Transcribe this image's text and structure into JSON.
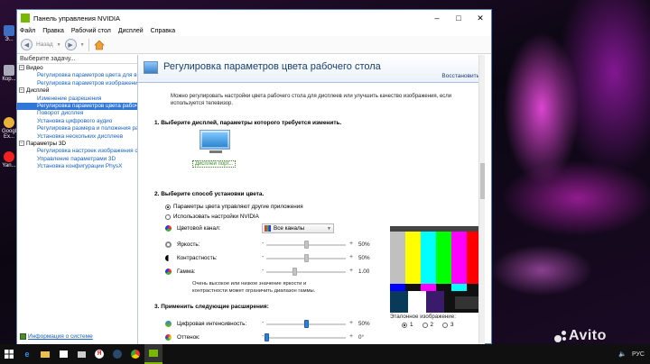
{
  "window": {
    "title": "Панель управления NVIDIA",
    "menu": [
      "Файл",
      "Правка",
      "Рабочий стол",
      "Дисплей",
      "Справка"
    ],
    "back_label": "Назад"
  },
  "desktop": {
    "icons": [
      {
        "label": "Э..."
      },
      {
        "label": "Кор..."
      },
      {
        "label": "Google Ex..."
      },
      {
        "label": "Yan..."
      }
    ]
  },
  "left_panel": {
    "header": "Выберите задачу...",
    "tree": [
      {
        "type": "cat",
        "label": "Видео"
      },
      {
        "type": "leaf",
        "label": "Регулировка параметров цвета для вид"
      },
      {
        "type": "leaf",
        "label": "Регулировка параметров изображения д"
      },
      {
        "type": "cat",
        "label": "Дисплей"
      },
      {
        "type": "leaf",
        "label": "Изменение разрешения"
      },
      {
        "type": "leaf",
        "label": "Регулировка параметров цвета рабочег",
        "selected": true
      },
      {
        "type": "leaf",
        "label": "Поворот дисплея"
      },
      {
        "type": "leaf",
        "label": "Установка цифрового аудио"
      },
      {
        "type": "leaf",
        "label": "Регулировка размера и положения рабоч"
      },
      {
        "type": "leaf",
        "label": "Установка нескольких дисплеев"
      },
      {
        "type": "cat",
        "label": "Параметры 3D"
      },
      {
        "type": "leaf",
        "label": "Регулировка настроек изображения с пр"
      },
      {
        "type": "leaf",
        "label": "Управление параметрами 3D"
      },
      {
        "type": "leaf",
        "label": "Установка конфигурации PhysX"
      }
    ],
    "footer_link": "Информация о системе"
  },
  "main": {
    "title": "Регулировка параметров цвета рабочего стола",
    "restore": "Восстановить",
    "description": "Можно регулировать настройки цвета рабочего стола для дисплеев или улучшить качество изображения, если используется телевизор.",
    "step1": "1. Выберите дисплей, параметры которого требуется изменить.",
    "display_label": "Дисплей порт...",
    "step2": "2. Выберите способ установки цвета.",
    "radio_other": "Параметры цвета управляют другие приложения",
    "radio_nvidia": "Использовать настройки NVIDIA",
    "channel_label": "Цветовой канал:",
    "channel_value": "Все каналы",
    "sliders": [
      {
        "label": "Яркость:",
        "value": "50%",
        "level": 0.5
      },
      {
        "label": "Контрастность:",
        "value": "50%",
        "level": 0.5
      },
      {
        "label": "Гамма:",
        "value": "1.00",
        "level": 0.35
      }
    ],
    "note": "Очень высокое или низкое значение яркости и контрастности может ограничить диапазон гаммы.",
    "step3": "3. Применить следующие расширения:",
    "enh_sliders": [
      {
        "label": "Цифровая интенсивность:",
        "value": "50%",
        "level": 0.5
      },
      {
        "label": "Оттенок:",
        "value": "0°",
        "level": 0.0
      }
    ],
    "reference_label": "Эталонное изображение:",
    "reference_options": [
      "1",
      "2",
      "3"
    ]
  },
  "taskbar": {
    "lang": "РУС",
    "watermark": "Avito"
  },
  "colors": {
    "nvidia_green": "#76b900",
    "link_blue": "#1660c8",
    "selection": "#3277d8"
  }
}
